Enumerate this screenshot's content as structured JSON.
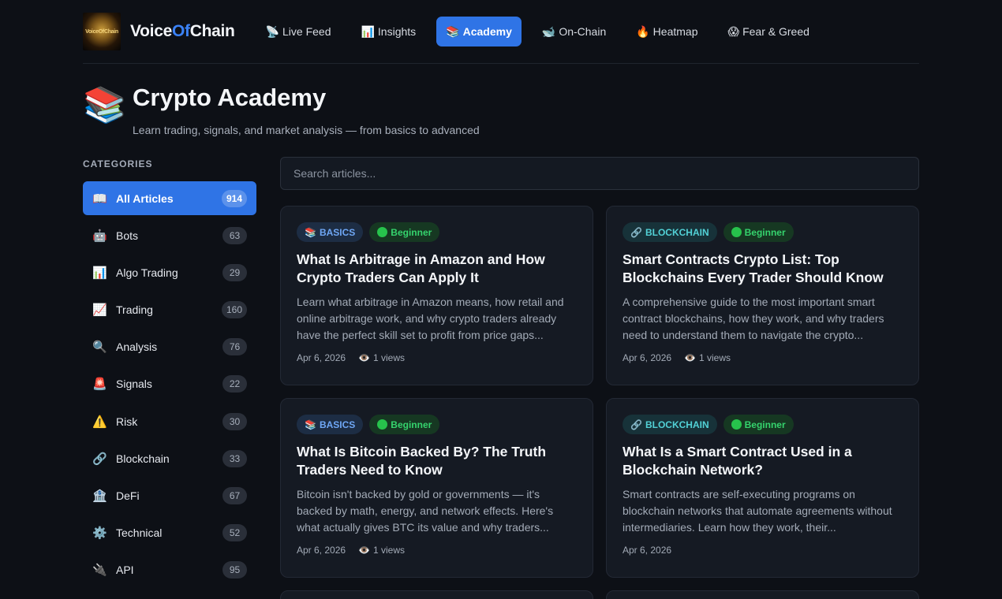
{
  "header": {
    "logo_text": "VoiceOfChain",
    "brand_part1": "Voice",
    "brand_part2": "Of",
    "brand_part3": "Chain",
    "nav": [
      {
        "icon": "📡",
        "label": "Live Feed"
      },
      {
        "icon": "📊",
        "label": "Insights"
      },
      {
        "icon": "📚",
        "label": "Academy"
      },
      {
        "icon": "🐋",
        "label": "On-Chain"
      },
      {
        "icon": "🔥",
        "label": "Heatmap"
      },
      {
        "icon": "😱",
        "label": "Fear & Greed"
      }
    ]
  },
  "hero": {
    "icon": "📚",
    "title": "Crypto Academy",
    "subtitle": "Learn trading, signals, and market analysis — from basics to advanced"
  },
  "sidebar": {
    "heading": "CATEGORIES",
    "items": [
      {
        "icon": "📖",
        "label": "All Articles",
        "count": "914"
      },
      {
        "icon": "🤖",
        "label": "Bots",
        "count": "63"
      },
      {
        "icon": "📊",
        "label": "Algo Trading",
        "count": "29"
      },
      {
        "icon": "📈",
        "label": "Trading",
        "count": "160"
      },
      {
        "icon": "🔍",
        "label": "Analysis",
        "count": "76"
      },
      {
        "icon": "🚨",
        "label": "Signals",
        "count": "22"
      },
      {
        "icon": "⚠️",
        "label": "Risk",
        "count": "30"
      },
      {
        "icon": "🔗",
        "label": "Blockchain",
        "count": "33"
      },
      {
        "icon": "🏦",
        "label": "DeFi",
        "count": "67"
      },
      {
        "icon": "⚙️",
        "label": "Technical",
        "count": "52"
      },
      {
        "icon": "🔌",
        "label": "API",
        "count": "95"
      }
    ]
  },
  "search": {
    "placeholder": "Search articles..."
  },
  "articles": [
    {
      "category_icon": "📚",
      "category": "BASICS",
      "level": "Beginner",
      "title": "What Is Arbitrage in Amazon and How Crypto Traders Can Apply It",
      "description": "Learn what arbitrage in Amazon means, how retail and online arbitrage work, and why crypto traders already have the perfect skill set to profit from price gaps...",
      "date": "Apr 6, 2026",
      "views_icon": "👁️",
      "views": "1 views"
    },
    {
      "category_icon": "🔗",
      "category": "BLOCKCHAIN",
      "level": "Beginner",
      "title": "Smart Contracts Crypto List: Top Blockchains Every Trader Should Know",
      "description": "A comprehensive guide to the most important smart contract blockchains, how they work, and why traders need to understand them to navigate the crypto...",
      "date": "Apr 6, 2026",
      "views_icon": "👁️",
      "views": "1 views"
    },
    {
      "category_icon": "📚",
      "category": "BASICS",
      "level": "Beginner",
      "title": "What Is Bitcoin Backed By? The Truth Traders Need to Know",
      "description": "Bitcoin isn't backed by gold or governments — it's backed by math, energy, and network effects. Here's what actually gives BTC its value and why traders...",
      "date": "Apr 6, 2026",
      "views_icon": "👁️",
      "views": "1 views"
    },
    {
      "category_icon": "🔗",
      "category": "BLOCKCHAIN",
      "level": "Beginner",
      "title": "What Is a Smart Contract Used in a Blockchain Network?",
      "description": "Smart contracts are self-executing programs on blockchain networks that automate agreements without intermediaries. Learn how they work, their...",
      "date": "Apr 6, 2026",
      "views_icon": "",
      "views": ""
    }
  ]
}
